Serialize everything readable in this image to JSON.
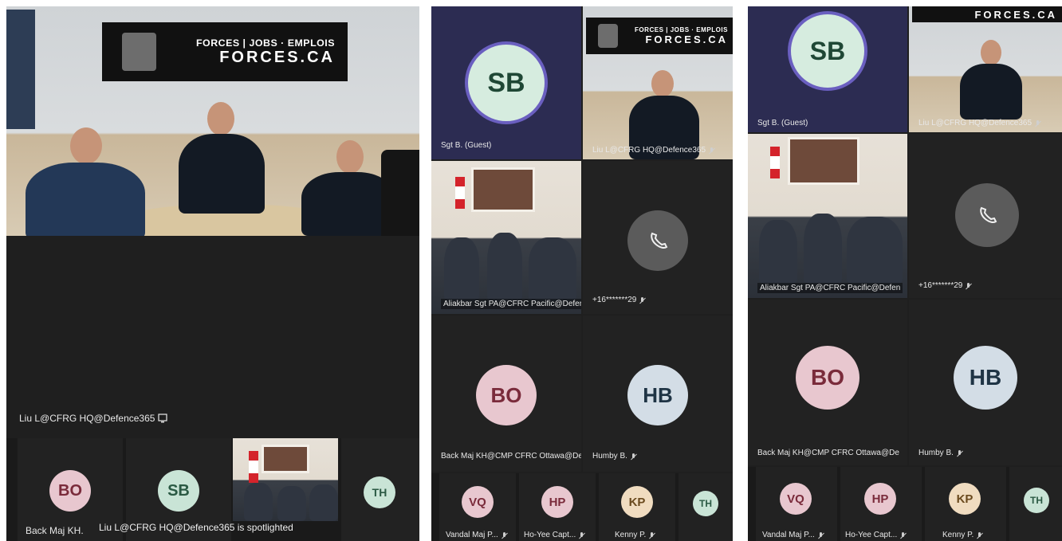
{
  "banner": {
    "line1": "FORCES | JOBS · EMPLOIS",
    "line2": "FORCES.CA"
  },
  "banner_partial": {
    "line2": "FORCES.CA"
  },
  "panel1": {
    "spotlight_name": "Liu L@CFRG HQ@Defence365",
    "strip": [
      {
        "initials": "BO",
        "name": "Back Maj KH.",
        "bg": "#e8c7cf",
        "fg": "#7a2b3b"
      },
      {
        "initials": "SB",
        "name": "",
        "bg": "#c9e4d6",
        "fg": "#2b5a44"
      },
      {
        "initials": "TH",
        "name": "",
        "bg": "#c9e4d6",
        "fg": "#2b5a44"
      }
    ],
    "toast": "Liu L@CFRG HQ@Defence365 is spotlighted"
  },
  "panel2": {
    "sb": {
      "initials": "SB",
      "name": "Sgt B. (Guest)",
      "bg": "#d6ecdf",
      "fg": "#1f4735"
    },
    "liu_name": "Liu L@CFRG HQ@Defence365",
    "aliakbar_name": "Aliakbar Sgt PA@CFRC Pacific@Defen",
    "phone_name": "+16*******29",
    "bo": {
      "initials": "BO",
      "name": "Back Maj KH@CMP CFRC Ottawa@De",
      "bg": "#e8c7cf",
      "fg": "#7a2b3b"
    },
    "hb": {
      "initials": "HB",
      "name": "Humby B.",
      "bg": "#d3dde6",
      "fg": "#1f3445"
    },
    "strip": [
      {
        "initials": "VQ",
        "name": "Vandal Maj P...",
        "bg": "#e8c7cf",
        "fg": "#7a2b3b"
      },
      {
        "initials": "HP",
        "name": "Ho-Yee Capt...",
        "bg": "#e8c7cf",
        "fg": "#7a2b3b"
      },
      {
        "initials": "KP",
        "name": "Kenny P.",
        "bg": "#f0dcc0",
        "fg": "#6a4a1e"
      },
      {
        "initials": "TH",
        "name": "",
        "bg": "#c9e4d6",
        "fg": "#2b5a44"
      }
    ]
  },
  "panel3": {
    "sb": {
      "initials": "SB",
      "name": "Sgt B. (Guest)",
      "bg": "#d6ecdf",
      "fg": "#1f4735"
    },
    "liu_name": "Liu L@CFRG HQ@Defence365",
    "aliakbar_name": "Aliakbar Sgt PA@CFRC Pacific@Defen",
    "phone_name": "+16*******29",
    "bo": {
      "initials": "BO",
      "name": "Back Maj KH@CMP CFRC Ottawa@De",
      "bg": "#e8c7cf",
      "fg": "#7a2b3b"
    },
    "hb": {
      "initials": "HB",
      "name": "Humby B.",
      "bg": "#d3dde6",
      "fg": "#1f3445"
    },
    "strip": [
      {
        "initials": "VQ",
        "name": "Vandal Maj P...",
        "bg": "#e8c7cf",
        "fg": "#7a2b3b"
      },
      {
        "initials": "HP",
        "name": "Ho-Yee Capt...",
        "bg": "#e8c7cf",
        "fg": "#7a2b3b"
      },
      {
        "initials": "KP",
        "name": "Kenny P.",
        "bg": "#f0dcc0",
        "fg": "#6a4a1e"
      },
      {
        "initials": "TH",
        "name": "",
        "bg": "#c9e4d6",
        "fg": "#2b5a44"
      }
    ]
  },
  "icons": {
    "mic_off": "mic-off-icon",
    "phone": "phone-icon",
    "screen": "screen-share-icon"
  }
}
